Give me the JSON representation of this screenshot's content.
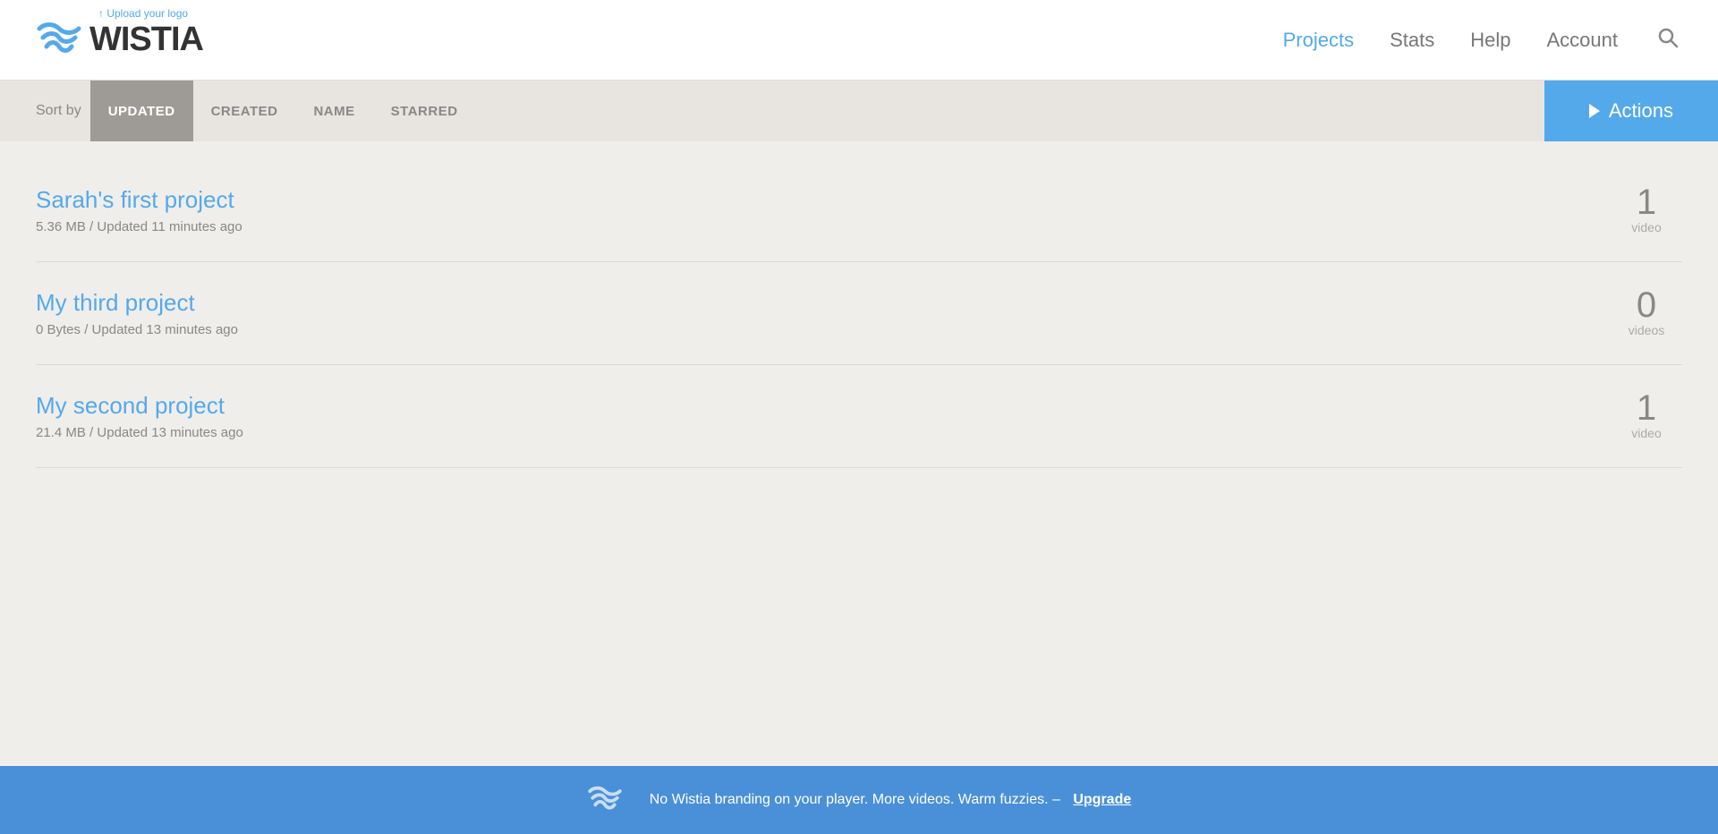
{
  "header": {
    "upload_logo_text": "↑ Upload your logo",
    "logo_text": "WISTIA",
    "nav": [
      {
        "label": "Projects",
        "active": true,
        "name": "projects"
      },
      {
        "label": "Stats",
        "active": false,
        "name": "stats"
      },
      {
        "label": "Help",
        "active": false,
        "name": "help"
      },
      {
        "label": "Account",
        "active": false,
        "name": "account"
      }
    ]
  },
  "sort_bar": {
    "sort_label": "Sort by",
    "sort_options": [
      {
        "label": "UPDATED",
        "active": true,
        "name": "updated"
      },
      {
        "label": "CREATED",
        "active": false,
        "name": "created"
      },
      {
        "label": "NAME",
        "active": false,
        "name": "name"
      },
      {
        "label": "STARRED",
        "active": false,
        "name": "starred"
      }
    ],
    "actions_label": "Actions"
  },
  "projects": [
    {
      "name": "Sarah's first project",
      "size": "5.36 MB",
      "updated": "Updated 11 minutes ago",
      "count": "1",
      "count_label": "video"
    },
    {
      "name": "My third project",
      "size": "0 Bytes",
      "updated": "Updated 13 minutes ago",
      "count": "0",
      "count_label": "videos"
    },
    {
      "name": "My second project",
      "size": "21.4 MB",
      "updated": "Updated 13 minutes ago",
      "count": "1",
      "count_label": "video"
    }
  ],
  "footer": {
    "message": "No Wistia branding on your player. More videos. Warm fuzzies. – ",
    "upgrade_label": "Upgrade"
  }
}
